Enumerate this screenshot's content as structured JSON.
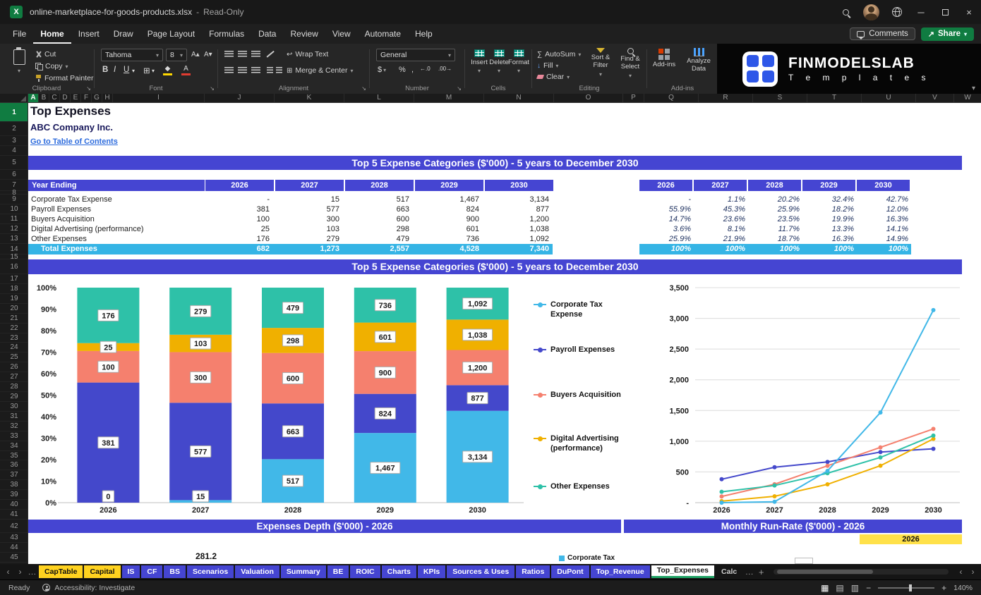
{
  "colors": {
    "banner_blue": "#4545d2",
    "total_cyan": "#35b4e5",
    "tab_yellow": "#ffd21f",
    "active_green": "#21a366",
    "link_blue": "#2c6bdd",
    "highlight_yellow": "#ffe14a",
    "excel_green": "#107c41"
  },
  "window": {
    "title": "online-marketplace-for-goods-products.xlsx",
    "separator": "-",
    "read_only_label": "Read-Only"
  },
  "menu": {
    "items": [
      "File",
      "Home",
      "Insert",
      "Draw",
      "Page Layout",
      "Formulas",
      "Data",
      "Review",
      "View",
      "Automate",
      "Help"
    ],
    "active": "Home",
    "comments_label": "Comments",
    "share_label": "Share"
  },
  "ribbon": {
    "clipboard": {
      "label": "Clipboard",
      "cut": "Cut",
      "copy": "Copy",
      "format_painter": "Format Painter"
    },
    "font": {
      "label": "Font",
      "font_name": "Tahoma",
      "font_size": "8"
    },
    "alignment": {
      "label": "Alignment",
      "wrap_text": "Wrap Text",
      "merge_center": "Merge & Center"
    },
    "number": {
      "label": "Number",
      "format": "General"
    },
    "cells": {
      "label": "Cells",
      "insert": "Insert",
      "del": "Delete",
      "format": "Format"
    },
    "editing": {
      "label": "Editing",
      "autosum": "AutoSum",
      "fill": "Fill",
      "clear": "Clear",
      "sort_filter": "Sort & Filter",
      "find_select": "Find & Select"
    },
    "addins": {
      "label": "Add-ins",
      "addins": "Add-ins",
      "analyze": "Analyze Data"
    },
    "brand": {
      "name": "FINMODELSLAB",
      "tagline": "T e m p l a t e s"
    }
  },
  "grid": {
    "columns": [
      "A",
      "B",
      "C",
      "D",
      "E",
      "F",
      "G",
      "H",
      "I",
      "J",
      "K",
      "L",
      "M",
      "N",
      "O",
      "P",
      "Q",
      "R",
      "S",
      "T",
      "U",
      "V",
      "W"
    ],
    "row_count": 45,
    "selected_column": "A",
    "selected_row": 1
  },
  "sheet": {
    "title": "Top Expenses",
    "company": "ABC Company Inc.",
    "toc_link": "Go to Table of Contents",
    "banner1": "Top 5 Expense Categories ($'000) - 5 years to December 2030",
    "banner2": "Top 5 Expense Categories ($'000) - 5 years to December 2030",
    "banner3": "Expenses Depth ($'000) - 2026",
    "banner4": "Monthly Run-Rate ($'000) - 2026",
    "table": {
      "header": "Year Ending",
      "years": [
        "2026",
        "2027",
        "2028",
        "2029",
        "2030"
      ],
      "rows": [
        {
          "label": "Corporate Tax Expense",
          "values": [
            "-",
            "15",
            "517",
            "1,467",
            "3,134"
          ]
        },
        {
          "label": "Payroll Expenses",
          "values": [
            "381",
            "577",
            "663",
            "824",
            "877"
          ]
        },
        {
          "label": "Buyers Acquisition",
          "values": [
            "100",
            "300",
            "600",
            "900",
            "1,200"
          ]
        },
        {
          "label": "Digital Advertising (performance)",
          "values": [
            "25",
            "103",
            "298",
            "601",
            "1,038"
          ]
        },
        {
          "label": "Other Expenses",
          "values": [
            "176",
            "279",
            "479",
            "736",
            "1,092"
          ]
        }
      ],
      "total_label": "Total Expenses",
      "total_values": [
        "682",
        "1,273",
        "2,557",
        "4,528",
        "7,340"
      ]
    },
    "pct_table": {
      "years": [
        "2026",
        "2027",
        "2028",
        "2029",
        "2030"
      ],
      "rows": [
        [
          "-",
          "1.1%",
          "20.2%",
          "32.4%",
          "42.7%"
        ],
        [
          "55.9%",
          "45.3%",
          "25.9%",
          "18.2%",
          "12.0%"
        ],
        [
          "14.7%",
          "23.6%",
          "23.5%",
          "19.9%",
          "16.3%"
        ],
        [
          "3.6%",
          "8.1%",
          "11.7%",
          "13.3%",
          "14.1%"
        ],
        [
          "25.9%",
          "21.9%",
          "18.7%",
          "16.3%",
          "14.9%"
        ]
      ],
      "total": [
        "100%",
        "100%",
        "100%",
        "100%",
        "100%"
      ]
    },
    "fragments": {
      "depth_value": "281.2",
      "depth_legend": "Corporate Tax",
      "runrate_year": "2026"
    }
  },
  "chart_data": [
    {
      "type": "bar",
      "variant": "stacked-100pct",
      "title": "Top 5 Expense Categories ($'000) - 5 years to December 2030",
      "categories": [
        "2026",
        "2027",
        "2028",
        "2029",
        "2030"
      ],
      "series": [
        {
          "name": "Corporate Tax Expense",
          "color": "#41b8e8",
          "values": [
            0,
            15,
            517,
            1467,
            3134
          ],
          "labels": [
            "0",
            "15",
            "517",
            "1,467",
            "3,134"
          ]
        },
        {
          "name": "Payroll Expenses",
          "color": "#4448cb",
          "values": [
            381,
            577,
            663,
            824,
            877
          ],
          "labels": [
            "381",
            "577",
            "663",
            "824",
            "877"
          ]
        },
        {
          "name": "Buyers Acquisition",
          "color": "#f5806e",
          "values": [
            100,
            300,
            600,
            900,
            1200
          ],
          "labels": [
            "100",
            "300",
            "600",
            "900",
            "1,200"
          ]
        },
        {
          "name": "Digital Advertising (performance)",
          "color": "#f0b000",
          "values": [
            25,
            103,
            298,
            601,
            1038
          ],
          "labels": [
            "25",
            "103",
            "298",
            "601",
            "1,038"
          ]
        },
        {
          "name": "Other Expenses",
          "color": "#2ec1a8",
          "values": [
            176,
            279,
            479,
            736,
            1092
          ],
          "labels": [
            "176",
            "279",
            "479",
            "736",
            "1,092"
          ]
        }
      ],
      "y_ticks": [
        "0%",
        "10%",
        "20%",
        "30%",
        "40%",
        "50%",
        "60%",
        "70%",
        "80%",
        "90%",
        "100%"
      ],
      "ylim": [
        0,
        1
      ],
      "grid": false,
      "legend_position": "right"
    },
    {
      "type": "line",
      "x": [
        "2026",
        "2027",
        "2028",
        "2029",
        "2030"
      ],
      "series": [
        {
          "name": "Corporate Tax Expense",
          "color": "#41b8e8",
          "values": [
            0,
            15,
            517,
            1467,
            3134
          ]
        },
        {
          "name": "Payroll Expenses",
          "color": "#4448cb",
          "values": [
            381,
            577,
            663,
            824,
            877
          ]
        },
        {
          "name": "Buyers Acquisition",
          "color": "#f5806e",
          "values": [
            100,
            300,
            600,
            900,
            1200
          ]
        },
        {
          "name": "Digital Advertising (performance)",
          "color": "#f0b000",
          "values": [
            25,
            103,
            298,
            601,
            1038
          ]
        },
        {
          "name": "Other Expenses",
          "color": "#2ec1a8",
          "values": [
            176,
            279,
            479,
            736,
            1092
          ]
        }
      ],
      "ylim": [
        0,
        3500
      ],
      "y_ticks": [
        "-",
        "500",
        "1,000",
        "1,500",
        "2,000",
        "2,500",
        "3,000",
        "3,500"
      ],
      "grid": true,
      "legend_position": "left"
    }
  ],
  "tabs": {
    "items": [
      {
        "label": "CapTable",
        "style": "yellow"
      },
      {
        "label": "Capital",
        "style": "yellow"
      },
      {
        "label": "IS",
        "style": "blue"
      },
      {
        "label": "CF",
        "style": "blue"
      },
      {
        "label": "BS",
        "style": "blue"
      },
      {
        "label": "Scenarios",
        "style": "blue"
      },
      {
        "label": "Valuation",
        "style": "blue"
      },
      {
        "label": "Summary",
        "style": "blue"
      },
      {
        "label": "BE",
        "style": "blue"
      },
      {
        "label": "ROIC",
        "style": "blue"
      },
      {
        "label": "Charts",
        "style": "blue"
      },
      {
        "label": "KPIs",
        "style": "blue"
      },
      {
        "label": "Sources & Uses",
        "style": "blue"
      },
      {
        "label": "Ratios",
        "style": "blue"
      },
      {
        "label": "DuPont",
        "style": "blue"
      },
      {
        "label": "Top_Revenue",
        "style": "blue"
      },
      {
        "label": "Top_Expenses",
        "style": "active"
      },
      {
        "label": "Calc",
        "style": "plain"
      }
    ],
    "add_label": "+"
  },
  "status": {
    "ready": "Ready",
    "accessibility": "Accessibility: Investigate",
    "zoom": "140%"
  },
  "icons": {
    "excel_logo": "X",
    "dropdown": "▾",
    "autosum": "∑",
    "fill": "↓",
    "borders": "⊞",
    "wrap": "↩",
    "bold": "B",
    "italic": "I",
    "underline": "U",
    "fill_swatch": "◆",
    "font_color": "A",
    "currency": "$",
    "percent": "%",
    "comma": ",",
    "inc_decimal": ".00→",
    "dec_decimal": "←.0",
    "grow_font": "A▴",
    "shrink_font": "A▾",
    "close": "×",
    "minimize": "─",
    "prev": "‹",
    "next": "›",
    "more": "…",
    "launcher": "↘",
    "minus": "−",
    "plus": "+",
    "view_normal": "▦",
    "view_layout": "▤",
    "view_break": "▥"
  }
}
